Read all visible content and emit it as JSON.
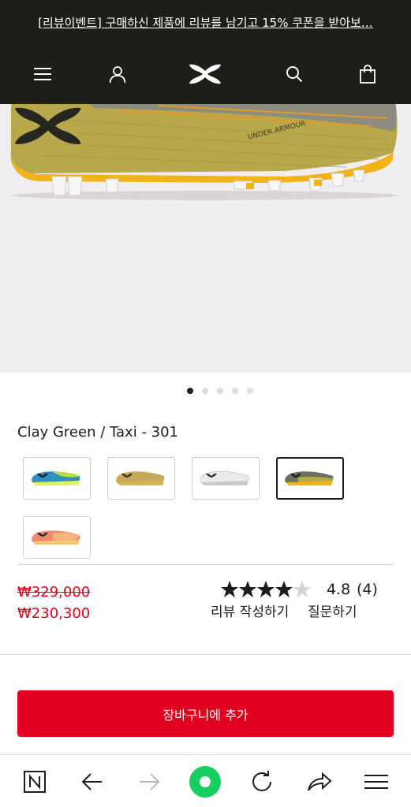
{
  "promo": {
    "text": "[리뷰이벤트] 구매하신 제품에 리뷰를 남기고 15% 쿠폰을 받아보…"
  },
  "header": {
    "icons": [
      "menu-icon",
      "account-icon",
      "under-armour-logo",
      "search-icon",
      "shopping-bag-icon"
    ]
  },
  "gallery": {
    "dot_count": 5,
    "active_index": 0,
    "hero_brand_text": "UNDER ARMOUR"
  },
  "product": {
    "color_name": "Clay Green / Taxi - 301",
    "swatches": [
      {
        "name": "blue-teal",
        "upper": "#2f8fbf",
        "sole": "#e6f15a",
        "selected": false
      },
      {
        "name": "gold",
        "upper": "#c7a95a",
        "sole": "#d7b451",
        "selected": false
      },
      {
        "name": "white",
        "upper": "#e4e4e4",
        "sole": "#c9c9c9",
        "selected": false
      },
      {
        "name": "clay-green-taxi",
        "upper": "#6f6f5d",
        "sole": "#f0b419",
        "selected": true
      },
      {
        "name": "coral",
        "upper": "#ef8b6b",
        "sole": "#f5c57a",
        "selected": false
      }
    ],
    "price_original": "₩329,000",
    "price_sale": "₩230,300",
    "rating": "4.8",
    "rating_fraction": 0.96,
    "review_count": "(4)",
    "write_review_label": "리뷰 작성하기",
    "question_label": "질문하기",
    "add_to_cart_label": "장바구니에 추가"
  },
  "colors": {
    "brand_red": "#e1001e",
    "header_bg": "#1d1e1a",
    "browser_accent": "#19ce60"
  },
  "browser_bar": {
    "icons": [
      "naver-n-icon",
      "back-arrow-icon",
      "forward-arrow-icon",
      "home-green-icon",
      "reload-icon",
      "share-icon",
      "hamburger-menu-icon"
    ]
  }
}
